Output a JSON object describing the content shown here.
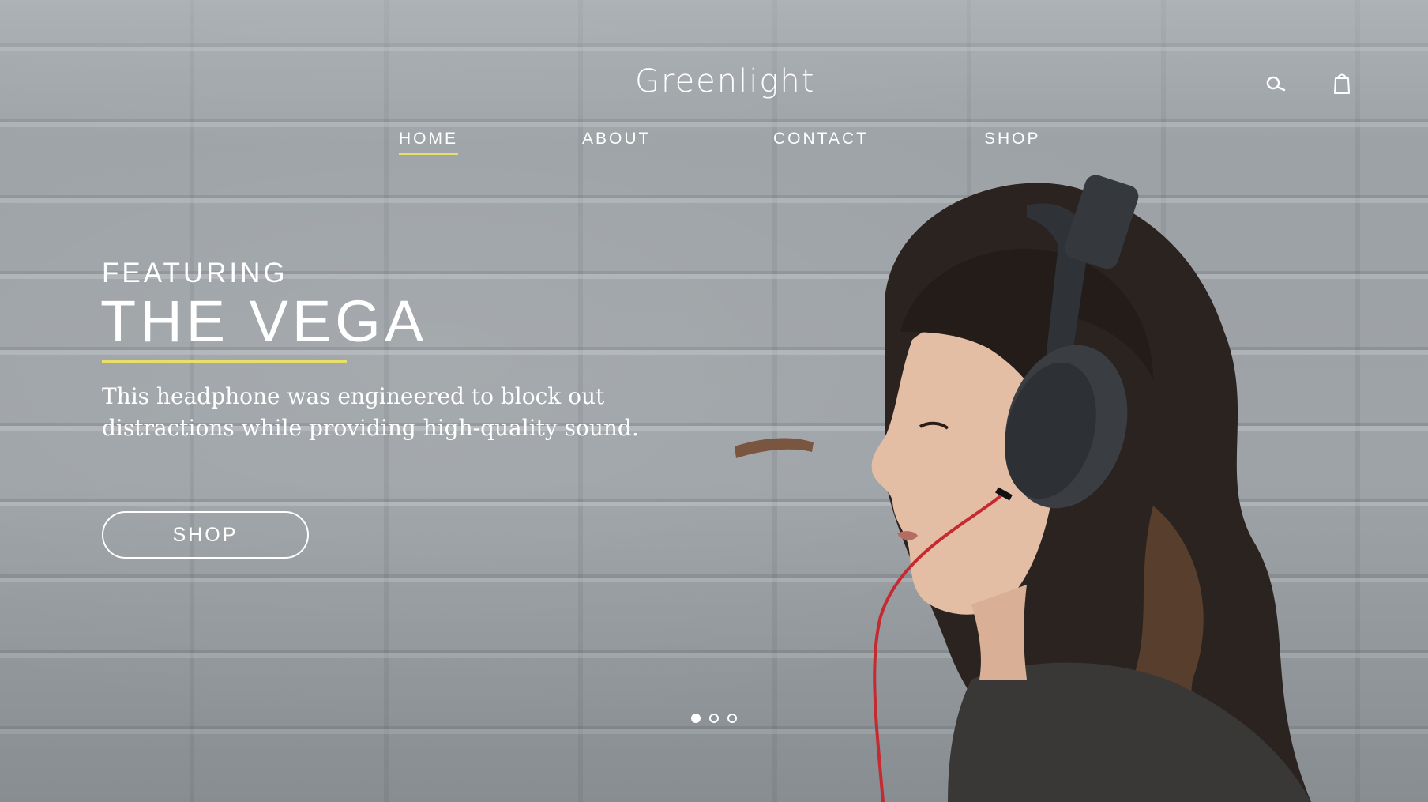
{
  "brand": {
    "logo_text": "Greenlight"
  },
  "header": {
    "icons": [
      "search-icon",
      "shopping-bag-icon"
    ]
  },
  "nav": {
    "items": [
      {
        "label": "HOME",
        "active": true
      },
      {
        "label": "ABOUT",
        "active": false
      },
      {
        "label": "CONTACT",
        "active": false
      },
      {
        "label": "SHOP",
        "active": false
      }
    ]
  },
  "hero": {
    "eyebrow": "FEATURING",
    "title": "THE VEGA",
    "description": "This headphone was engineered to block out distractions while providing high-quality sound.",
    "cta_label": "SHOP"
  },
  "slider": {
    "count": 3,
    "active_index": 0
  },
  "colors": {
    "accent": "#e8df6a",
    "text": "#ffffff",
    "background": "#9ea3a7"
  }
}
